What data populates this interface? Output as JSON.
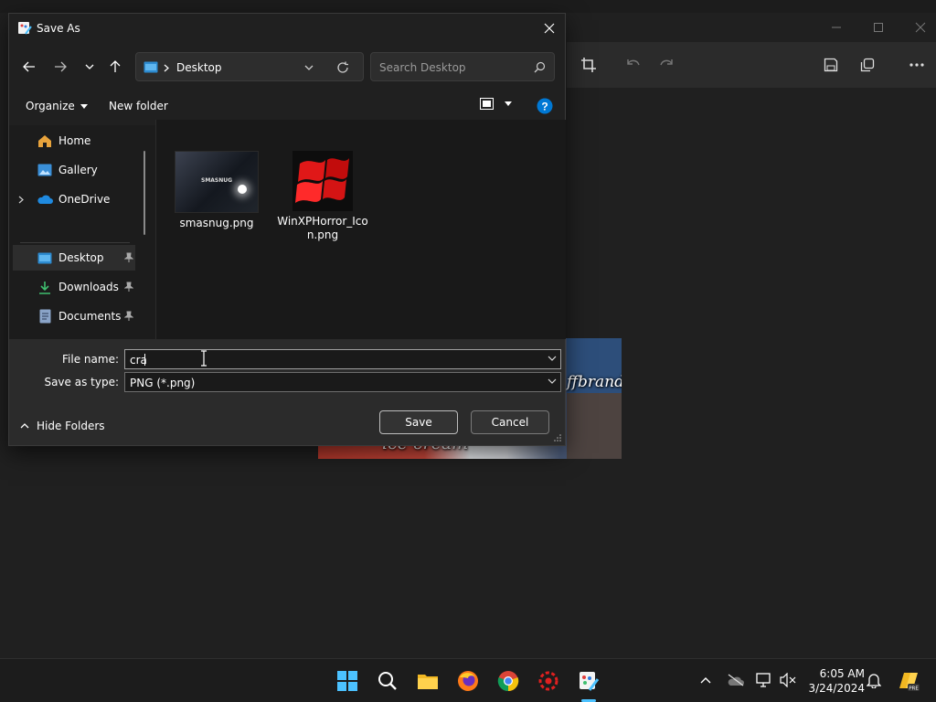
{
  "dialog": {
    "title": "Save As",
    "address": {
      "location": "Desktop"
    },
    "search": {
      "placeholder": "Search Desktop"
    },
    "commands": {
      "organize": "Organize",
      "new_folder": "New folder"
    },
    "nav_items": [
      {
        "label": "Home",
        "icon": "home-icon",
        "pinned": false
      },
      {
        "label": "Gallery",
        "icon": "gallery-icon",
        "pinned": false
      },
      {
        "label": "OneDrive",
        "icon": "onedrive-icon",
        "pinned": false
      },
      {
        "label": "Desktop",
        "icon": "desktop-folder-icon",
        "pinned": true,
        "selected": true
      },
      {
        "label": "Downloads",
        "icon": "downloads-icon",
        "pinned": true
      },
      {
        "label": "Documents",
        "icon": "documents-icon",
        "pinned": true
      }
    ],
    "files": [
      {
        "name": "smasnug.png",
        "thumb_text": "SMASNUG"
      },
      {
        "name": "WinXPHorror_Icon.png"
      }
    ],
    "file_name": {
      "label": "File name:",
      "value": "cra"
    },
    "save_as_type": {
      "label": "Save as type:",
      "value": "PNG (*.png)"
    },
    "hide_folders": "Hide Folders",
    "save_label": "Save",
    "cancel_label": "Cancel"
  },
  "background_image": {
    "caption_left": "ice cream",
    "caption_right": "ffbrands"
  },
  "taskbar": {
    "time": "6:05 AM",
    "date": "3/24/2024"
  },
  "colors": {
    "accent": "#4cc2ff",
    "help": "#0078d4",
    "flag_red": "#e01818"
  }
}
